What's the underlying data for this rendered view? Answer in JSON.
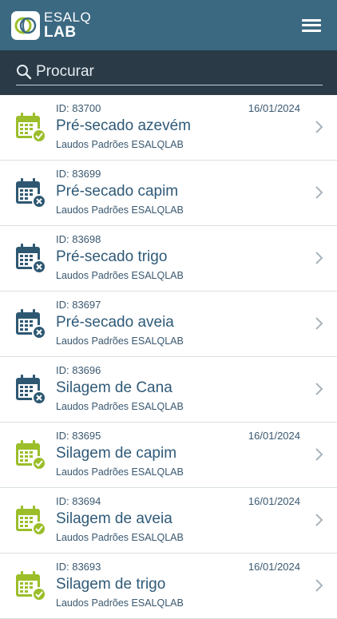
{
  "header": {
    "logo_line1": "ESALQ",
    "logo_line2": "LAB"
  },
  "search": {
    "placeholder": "Procurar"
  },
  "colors": {
    "header_bg": "#3c6982",
    "search_bg": "#2a3a47",
    "done_green": "#9bbe2a",
    "pending_blue": "#2e5872"
  },
  "items": [
    {
      "id": "ID: 83700",
      "date": "16/01/2024",
      "title": "Pré-secado azevém",
      "subtitle": "Laudos Padrões ESALQLAB",
      "status": "done"
    },
    {
      "id": "ID: 83699",
      "date": "",
      "title": "Pré-secado capim",
      "subtitle": "Laudos Padrões ESALQLAB",
      "status": "pending"
    },
    {
      "id": "ID: 83698",
      "date": "",
      "title": "Pré-secado trigo",
      "subtitle": "Laudos Padrões ESALQLAB",
      "status": "pending"
    },
    {
      "id": "ID: 83697",
      "date": "",
      "title": "Pré-secado aveia",
      "subtitle": "Laudos Padrões ESALQLAB",
      "status": "pending"
    },
    {
      "id": "ID: 83696",
      "date": "",
      "title": "Silagem de Cana",
      "subtitle": "Laudos Padrões ESALQLAB",
      "status": "pending"
    },
    {
      "id": "ID: 83695",
      "date": "16/01/2024",
      "title": "Silagem de capim",
      "subtitle": "Laudos Padrões ESALQLAB",
      "status": "done"
    },
    {
      "id": "ID: 83694",
      "date": "16/01/2024",
      "title": "Silagem de aveia",
      "subtitle": "Laudos Padrões ESALQLAB",
      "status": "done"
    },
    {
      "id": "ID: 83693",
      "date": "16/01/2024",
      "title": "Silagem de trigo",
      "subtitle": "Laudos Padrões ESALQLAB",
      "status": "done"
    }
  ]
}
